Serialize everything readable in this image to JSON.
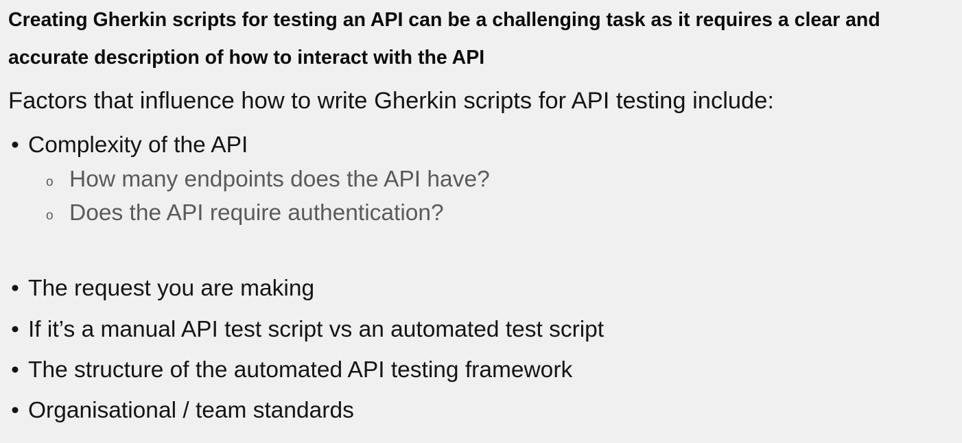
{
  "heading": "Creating Gherkin scripts for testing an API can be a challenging task as it requires a clear and accurate description of how to interact with the API",
  "intro": "Factors that influence how to write Gherkin scripts for API testing include:",
  "bullets": [
    {
      "marker": "•",
      "text": "Complexity of the API",
      "sub": [
        {
          "marker": "o",
          "text": "How many endpoints does the API have?"
        },
        {
          "marker": "o",
          "text": "Does the API require authentication?"
        }
      ]
    },
    {
      "marker": "•",
      "text": "The request you are making"
    },
    {
      "marker": "•",
      "text": "If it’s a manual API test script vs an automated test script"
    },
    {
      "marker": "•",
      "text": "The structure of the automated API testing framework"
    },
    {
      "marker": "•",
      "text": "Organisational / team standards"
    }
  ]
}
